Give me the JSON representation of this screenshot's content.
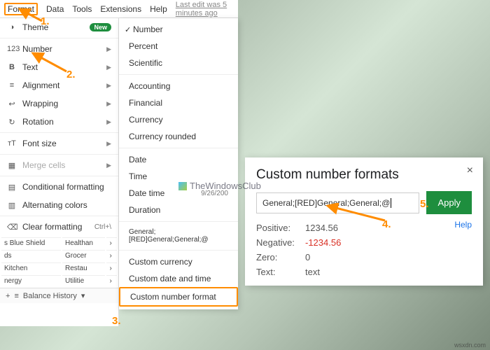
{
  "topbar": {
    "format": "Format",
    "data": "Data",
    "tools": "Tools",
    "extensions": "Extensions",
    "help": "Help",
    "lastedit": "Last edit was 5 minutes ago"
  },
  "leftpanel": {
    "theme": "Theme",
    "new": "New",
    "number": "Number",
    "text": "Text",
    "alignment": "Alignment",
    "wrapping": "Wrapping",
    "rotation": "Rotation",
    "fontsize": "Font size",
    "mergecells": "Merge cells",
    "conditional": "Conditional formatting",
    "alternating": "Alternating colors",
    "clear": "Clear formatting",
    "clear_shortcut": "Ctrl+\\",
    "tableA": {
      "r1c1": "s Blue Shield",
      "r1c2": "Healthan",
      "r2c1": "ds",
      "r2c2": "Grocer",
      "r3c1": "Kitchen",
      "r3c2": "Restau",
      "r4c1": "nergy",
      "r4c2": "Utilitie"
    },
    "tab_plus": "+",
    "tab_menu": "≡",
    "tab_name": "Balance History",
    "tab_caret": "▾"
  },
  "submenu": {
    "number": "Number",
    "percent": "Percent",
    "scientific": "Scientific",
    "accounting": "Accounting",
    "financial": "Financial",
    "currency": "Currency",
    "currency_rounded": "Currency rounded",
    "date": "Date",
    "time": "Time",
    "datetime": "Date time",
    "datetime_sample": "9/26/200",
    "duration": "Duration",
    "recent": "General;[RED]General;General;@",
    "custom_currency": "Custom currency",
    "custom_datetime": "Custom date and time",
    "custom_number": "Custom number format"
  },
  "dialog": {
    "title": "Custom number formats",
    "input": "General;[RED]General;General;@",
    "apply": "Apply",
    "pos_lbl": "Positive:",
    "pos_val": "1234.56",
    "neg_lbl": "Negative:",
    "neg_val": "-1234.56",
    "zero_lbl": "Zero:",
    "zero_val": "0",
    "text_lbl": "Text:",
    "text_val": "text",
    "help": "Help"
  },
  "steps": {
    "s1": "1.",
    "s2": "2.",
    "s3": "3.",
    "s4": "4.",
    "s5": "5."
  },
  "watermark": "TheWindowsClub",
  "credit": "wsxdn.com"
}
